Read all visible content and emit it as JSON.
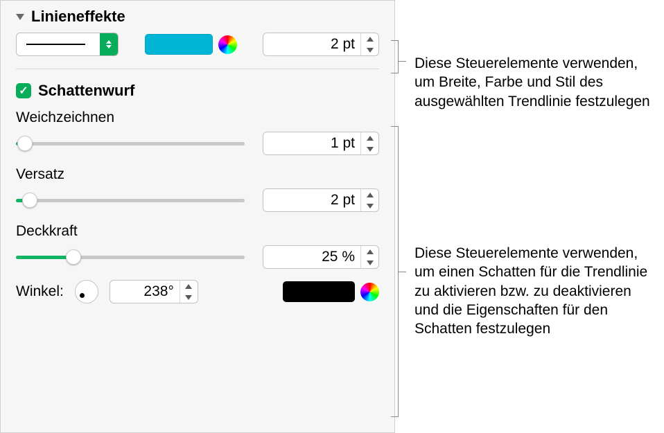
{
  "linieneffekte": {
    "title": "Linieneffekte",
    "stroke_width": "2 pt"
  },
  "schattenwurf": {
    "title": "Schattenwurf",
    "weichzeichnen": {
      "label": "Weichzeichnen",
      "value": "1 pt",
      "percent": 4
    },
    "versatz": {
      "label": "Versatz",
      "value": "2 pt",
      "percent": 6
    },
    "deckkraft": {
      "label": "Deckkraft",
      "value": "25 %",
      "percent": 25
    },
    "winkel": {
      "label": "Winkel:",
      "value": "238°"
    }
  },
  "annotations": {
    "top": "Diese Steuerelemente verwenden, um Breite, Farbe und Stil des ausgewählten Trendlinie festzulegen",
    "bottom": "Diese Steuerelemente verwenden, um einen Schatten für die Trendlinie zu aktivieren bzw. zu deaktivieren und die Eigenschaften für den Schatten festzulegen"
  }
}
